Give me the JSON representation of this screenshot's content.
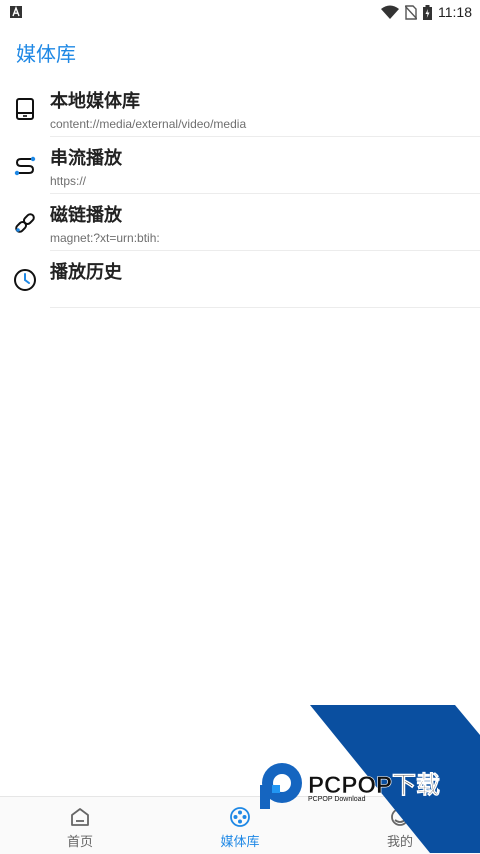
{
  "status_bar": {
    "time": "11:18",
    "left_icon": "a-notification-icon",
    "icons": [
      "wifi-icon",
      "no-sim-icon",
      "battery-charging-icon"
    ]
  },
  "app_bar": {
    "title": "媒体库"
  },
  "list": {
    "items": [
      {
        "title": "本地媒体库",
        "subtitle": "content://media/external/video/media",
        "icon": "tablet-icon"
      },
      {
        "title": "串流播放",
        "subtitle": "https://",
        "icon": "stream-path-icon"
      },
      {
        "title": "磁链播放",
        "subtitle": "magnet:?xt=urn:btih:",
        "icon": "link-icon"
      },
      {
        "title": "播放历史",
        "subtitle": "",
        "icon": "clock-icon"
      }
    ]
  },
  "bottom_nav": {
    "items": [
      {
        "label": "首页",
        "icon": "home-icon",
        "active": false
      },
      {
        "label": "媒体库",
        "icon": "film-reel-icon",
        "active": true
      },
      {
        "label": "我的",
        "icon": "profile-icon",
        "active": false
      }
    ]
  },
  "watermark": {
    "brand": "PCPOP下载",
    "tagline": "PCPOP Download"
  },
  "colors": {
    "accent": "#1e88e5",
    "watermark_blue": "#0a4fa0"
  }
}
